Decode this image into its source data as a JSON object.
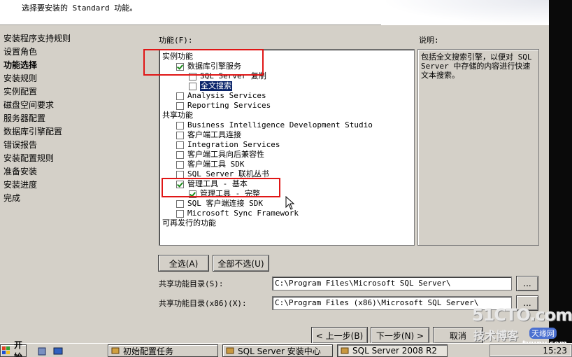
{
  "header": {
    "text": "选择要安装的 Standard 功能。"
  },
  "steps": [
    {
      "label": "安装程序支持规则",
      "active": false
    },
    {
      "label": "设置角色",
      "active": false
    },
    {
      "label": "功能选择",
      "active": true
    },
    {
      "label": "安装规则",
      "active": false
    },
    {
      "label": "实例配置",
      "active": false
    },
    {
      "label": "磁盘空间要求",
      "active": false
    },
    {
      "label": "服务器配置",
      "active": false
    },
    {
      "label": "数据库引擎配置",
      "active": false
    },
    {
      "label": "错误报告",
      "active": false
    },
    {
      "label": "安装配置规则",
      "active": false
    },
    {
      "label": "准备安装",
      "active": false
    },
    {
      "label": "安装进度",
      "active": false
    },
    {
      "label": "完成",
      "active": false
    }
  ],
  "features": {
    "label": "功能(F):",
    "groups": {
      "instance": "实例功能",
      "shared": "共享功能",
      "redistributable": "可再发行的功能"
    },
    "items": {
      "db_engine": {
        "label": "数据库引擎服务",
        "checked": true
      },
      "replication": {
        "label": "SQL Server 复制",
        "checked": false
      },
      "fulltext": {
        "label": "全文搜索",
        "checked": false
      },
      "analysis": {
        "label": "Analysis Services",
        "checked": false
      },
      "reporting": {
        "label": "Reporting Services",
        "checked": false
      },
      "bids": {
        "label": "Business Intelligence Development Studio",
        "checked": false
      },
      "client_conn": {
        "label": "客户端工具连接",
        "checked": false
      },
      "integration": {
        "label": "Integration Services",
        "checked": false
      },
      "client_compat": {
        "label": "客户端工具向后兼容性",
        "checked": false
      },
      "client_sdk": {
        "label": "客户端工具 SDK",
        "checked": false
      },
      "books_online": {
        "label": "SQL Server 联机丛书",
        "checked": false
      },
      "mgmt_basic": {
        "label": "管理工具 - 基本",
        "checked": true
      },
      "mgmt_complete": {
        "label": "管理工具 - 完整",
        "checked": true
      },
      "conn_sdk": {
        "label": "SQL 客户端连接 SDK",
        "checked": false
      },
      "sync": {
        "label": "Microsoft Sync Framework",
        "checked": false
      }
    }
  },
  "description": {
    "label": "说明:",
    "text": "包括全文搜索引擎，以便对 SQL Server 中存储的内容进行快速文本搜索。"
  },
  "buttons": {
    "select_all": "全选(A)",
    "unselect_all": "全部不选(U)",
    "browse": "...",
    "back": "< 上一步(B)",
    "next": "下一步(N) >",
    "cancel": "取消"
  },
  "dirs": {
    "shared_label": "共享功能目录(S):",
    "shared_value": "C:\\Program Files\\Microsoft SQL Server\\",
    "shared_x86_label": "共享功能目录(x86)(X):",
    "shared_x86_value": "C:\\Program Files (x86)\\Microsoft SQL Server\\"
  },
  "taskbar": {
    "start": "开始",
    "tasks": [
      "初始配置任务",
      "SQL Server 安装中心",
      "SQL Server 2008 R2"
    ],
    "clock": "15:23"
  },
  "watermark": {
    "line1": "51CTO.com",
    "line2": "技术博客",
    "line3": "天缘网",
    "line4": "tyunv.com"
  }
}
